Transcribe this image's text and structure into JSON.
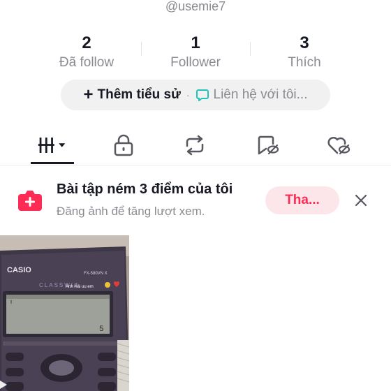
{
  "profile": {
    "username": "@usemie7"
  },
  "stats": [
    {
      "count": "2",
      "label": "Đã follow"
    },
    {
      "count": "1",
      "label": "Follower"
    },
    {
      "count": "3",
      "label": "Thích"
    }
  ],
  "bio": {
    "add_label": "Thêm tiểu sử",
    "separator": "·",
    "contact_label": "Liên hệ với tôi..."
  },
  "tabs": [
    {
      "name": "videos-grid",
      "icon": "grid-icon"
    },
    {
      "name": "private",
      "icon": "lock-icon"
    },
    {
      "name": "reposts",
      "icon": "repost-icon"
    },
    {
      "name": "favorites",
      "icon": "bookmark-hidden-icon"
    },
    {
      "name": "liked",
      "icon": "heart-hidden-icon"
    }
  ],
  "banner": {
    "title": "Bài tập ném 3 điểm của tôi",
    "subtitle": "Đăng ảnh để tăng lượt xem.",
    "button_label": "Tha...",
    "accent": "#fe2c55"
  },
  "video": {
    "brand": "CASIO",
    "model": "FX-580VN X",
    "series": "CLASSWIZ",
    "display_value": "5",
    "caption": "Anh Hải uu em"
  }
}
